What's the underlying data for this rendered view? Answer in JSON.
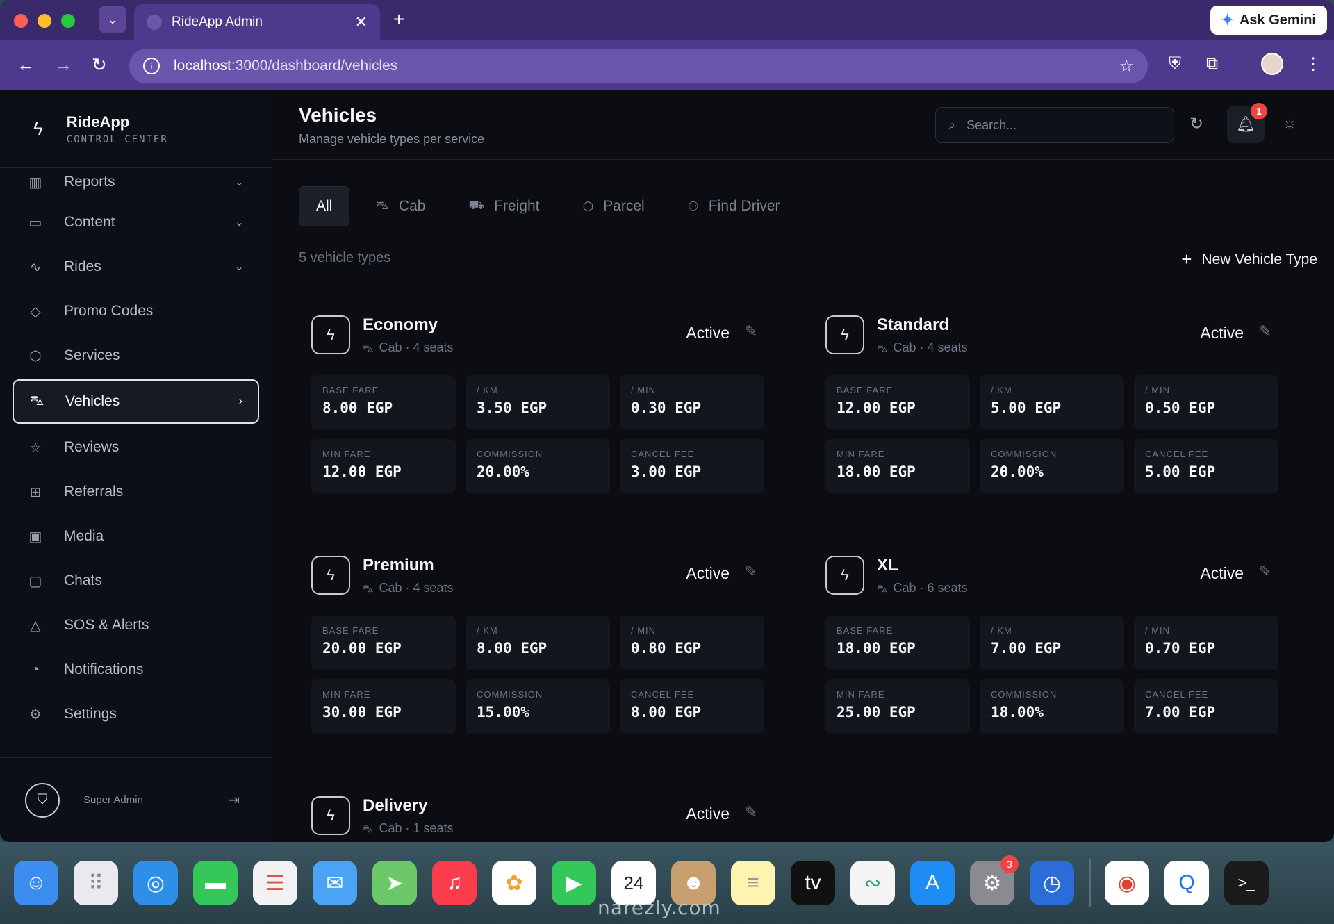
{
  "browser": {
    "tab_title": "RideApp Admin",
    "tab_close": "✕",
    "new_tab": "+",
    "ask_gemini": "Ask Gemini",
    "url_host": "localhost",
    "url_path": ":3000/dashboard/vehicles"
  },
  "brand": {
    "name": "RideApp",
    "subtitle": "CONTROL CENTER"
  },
  "sidebar": {
    "items": [
      {
        "label": "Reports",
        "icon": "bar-chart-icon",
        "glyph": "▥",
        "chevron": "⌄"
      },
      {
        "label": "Content",
        "icon": "book-icon",
        "glyph": "▭",
        "chevron": "⌄"
      },
      {
        "label": "Rides",
        "icon": "activity-icon",
        "glyph": "∿",
        "chevron": "⌄"
      },
      {
        "label": "Promo Codes",
        "icon": "tag-icon",
        "glyph": "◇",
        "chevron": ""
      },
      {
        "label": "Services",
        "icon": "package-icon",
        "glyph": "⬡",
        "chevron": ""
      },
      {
        "label": "Vehicles",
        "icon": "car-icon",
        "glyph": "⛍",
        "chevron": "›"
      },
      {
        "label": "Reviews",
        "icon": "star-icon",
        "glyph": "☆",
        "chevron": ""
      },
      {
        "label": "Referrals",
        "icon": "gift-icon",
        "glyph": "⊞",
        "chevron": ""
      },
      {
        "label": "Media",
        "icon": "image-icon",
        "glyph": "▣",
        "chevron": ""
      },
      {
        "label": "Chats",
        "icon": "message-icon",
        "glyph": "▢",
        "chevron": ""
      },
      {
        "label": "SOS & Alerts",
        "icon": "alert-icon",
        "glyph": "△",
        "chevron": ""
      },
      {
        "label": "Notifications",
        "icon": "bell-icon",
        "glyph": "◔",
        "chevron": ""
      },
      {
        "label": "Settings",
        "icon": "gear-icon",
        "glyph": "⚙",
        "chevron": ""
      }
    ],
    "active": "Vehicles",
    "footer_user": "Super Admin"
  },
  "header": {
    "title": "Vehicles",
    "subtitle": "Manage vehicle types per service",
    "search_placeholder": "Search...",
    "notification_count": "1"
  },
  "filters": [
    {
      "label": "All",
      "icon": "",
      "active": true
    },
    {
      "label": "Cab",
      "icon": "car-icon",
      "active": false
    },
    {
      "label": "Freight",
      "icon": "truck-icon",
      "active": false
    },
    {
      "label": "Parcel",
      "icon": "package-icon",
      "active": false
    },
    {
      "label": "Find Driver",
      "icon": "user-search-icon",
      "active": false
    }
  ],
  "vehicle_count": "5 vehicle types",
  "new_vehicle_button": "New Vehicle Type",
  "stat_labels": [
    "BASE FARE",
    "/ KM",
    "/ MIN",
    "MIN FARE",
    "COMMISSION",
    "CANCEL FEE"
  ],
  "vehicles": [
    {
      "name": "Economy",
      "meta": "Cab · 4 seats",
      "status": "Active",
      "stats": [
        "8.00 EGP",
        "3.50 EGP",
        "0.30 EGP",
        "12.00 EGP",
        "20.00%",
        "3.00 EGP"
      ]
    },
    {
      "name": "Standard",
      "meta": "Cab · 4 seats",
      "status": "Active",
      "stats": [
        "12.00 EGP",
        "5.00 EGP",
        "0.50 EGP",
        "18.00 EGP",
        "20.00%",
        "5.00 EGP"
      ]
    },
    {
      "name": "Premium",
      "meta": "Cab · 4 seats",
      "status": "Active",
      "stats": [
        "20.00 EGP",
        "8.00 EGP",
        "0.80 EGP",
        "30.00 EGP",
        "15.00%",
        "8.00 EGP"
      ]
    },
    {
      "name": "XL",
      "meta": "Cab · 6 seats",
      "status": "Active",
      "stats": [
        "18.00 EGP",
        "7.00 EGP",
        "0.70 EGP",
        "25.00 EGP",
        "18.00%",
        "7.00 EGP"
      ]
    },
    {
      "name": "Delivery",
      "meta": "Cab · 1 seats",
      "status": "Active",
      "stats": []
    }
  ],
  "dock": {
    "calendar_day": "24",
    "settings_badge": "3",
    "watermark": "narezly.com"
  }
}
